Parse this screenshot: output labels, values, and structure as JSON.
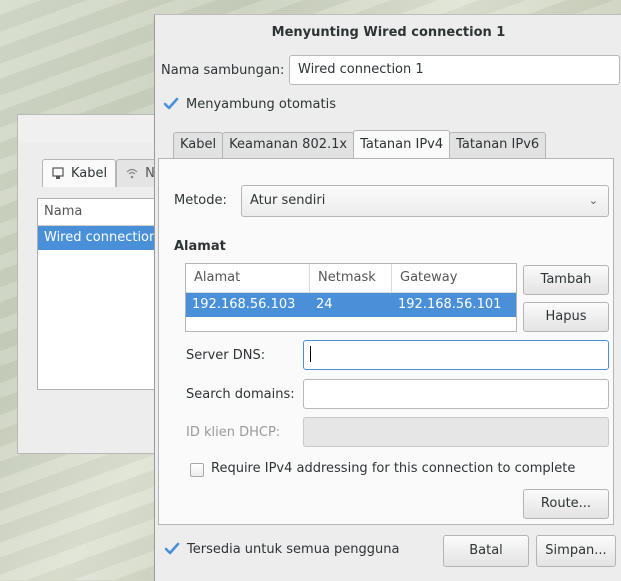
{
  "background_window": {
    "tabs": [
      {
        "label": "Kabel",
        "icon": "network-wired-icon"
      },
      {
        "label": "N",
        "icon": "wireless-icon"
      }
    ],
    "list_header": "Nama",
    "list_rows": [
      "Wired connection"
    ]
  },
  "dialog": {
    "title": "Menyunting Wired connection 1",
    "connection_name_label": "Nama sambungan:",
    "connection_name_value": "Wired connection 1",
    "auto_connect_label": "Menyambung otomatis",
    "auto_connect_checked": true,
    "tabs": [
      "Kabel",
      "Keamanan 802.1x",
      "Tatanan IPv4",
      "Tatanan IPv6"
    ],
    "active_tab": "Tatanan IPv4",
    "method_label": "Metode:",
    "method_value": "Atur sendiri",
    "addresses_heading": "Alamat",
    "table": {
      "columns": [
        "Alamat",
        "Netmask",
        "Gateway"
      ],
      "rows": [
        {
          "address": "192.168.56.103",
          "netmask": "24",
          "gateway": "192.168.56.101"
        }
      ]
    },
    "add_button": "Tambah",
    "delete_button": "Hapus",
    "dns_label": "Server DNS:",
    "dns_value": "",
    "search_domains_label": "Search domains:",
    "search_domains_value": "",
    "dhcp_client_id_label": "ID klien DHCP:",
    "dhcp_client_id_value": "",
    "require_ipv4_label": "Require IPv4 addressing for this connection to complete",
    "require_ipv4_checked": false,
    "routes_button": "Route...",
    "all_users_label": "Tersedia untuk semua pengguna",
    "all_users_checked": true,
    "cancel_button": "Batal",
    "save_button": "Simpan..."
  },
  "colors": {
    "selection": "#4a90d9",
    "focus": "#4a90d9",
    "dialog_bg": "#ededed"
  }
}
